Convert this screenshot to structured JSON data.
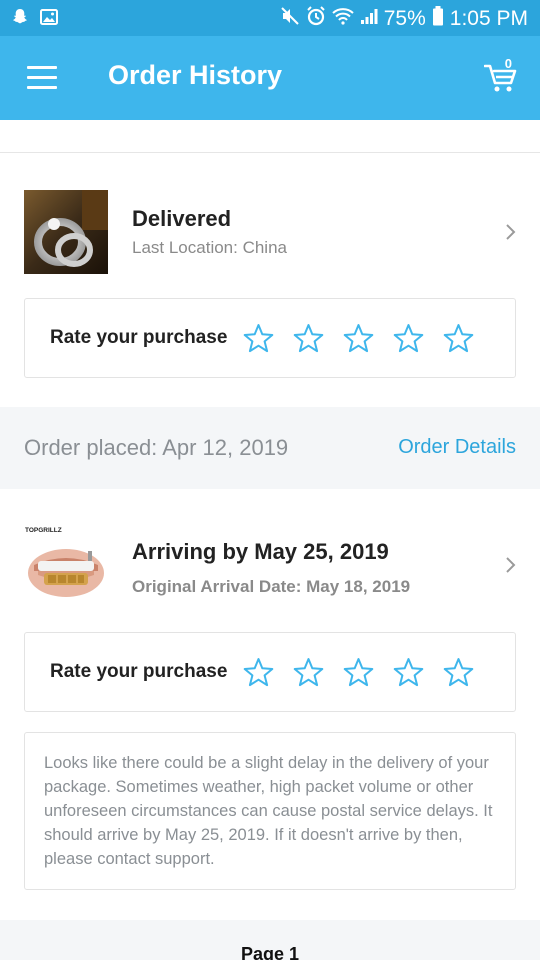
{
  "status_bar": {
    "battery": "75%",
    "time": "1:05 PM",
    "icons": [
      "snapchat-icon",
      "image-icon",
      "mute-icon",
      "alarm-icon",
      "wifi-icon",
      "signal-icon",
      "battery-icon"
    ]
  },
  "app_bar": {
    "title": "Order History",
    "cart_count": "0",
    "color": "#3eb6ec"
  },
  "orders": [
    {
      "status_title": "Delivered",
      "status_sub": "Last Location: China",
      "rate_label": "Rate your purchase"
    },
    {
      "placed_label": "Order placed: Apr 12, 2019",
      "details_link": "Order Details",
      "thumb_brand": "TOPGRILLZ",
      "status_title": "Arriving by May 25, 2019",
      "status_sub": "Original Arrival Date: May 18, 2019",
      "rate_label": "Rate your purchase",
      "notice": "Looks like there could be a slight delay in the delivery of your package. Sometimes weather, high packet volume or other unforeseen circumstances can cause postal service delays. It should arrive by May 25, 2019. If it doesn't arrive by then, please contact support."
    }
  ],
  "pagination": {
    "label": "Page 1"
  },
  "accent_color": "#2ca5dc"
}
